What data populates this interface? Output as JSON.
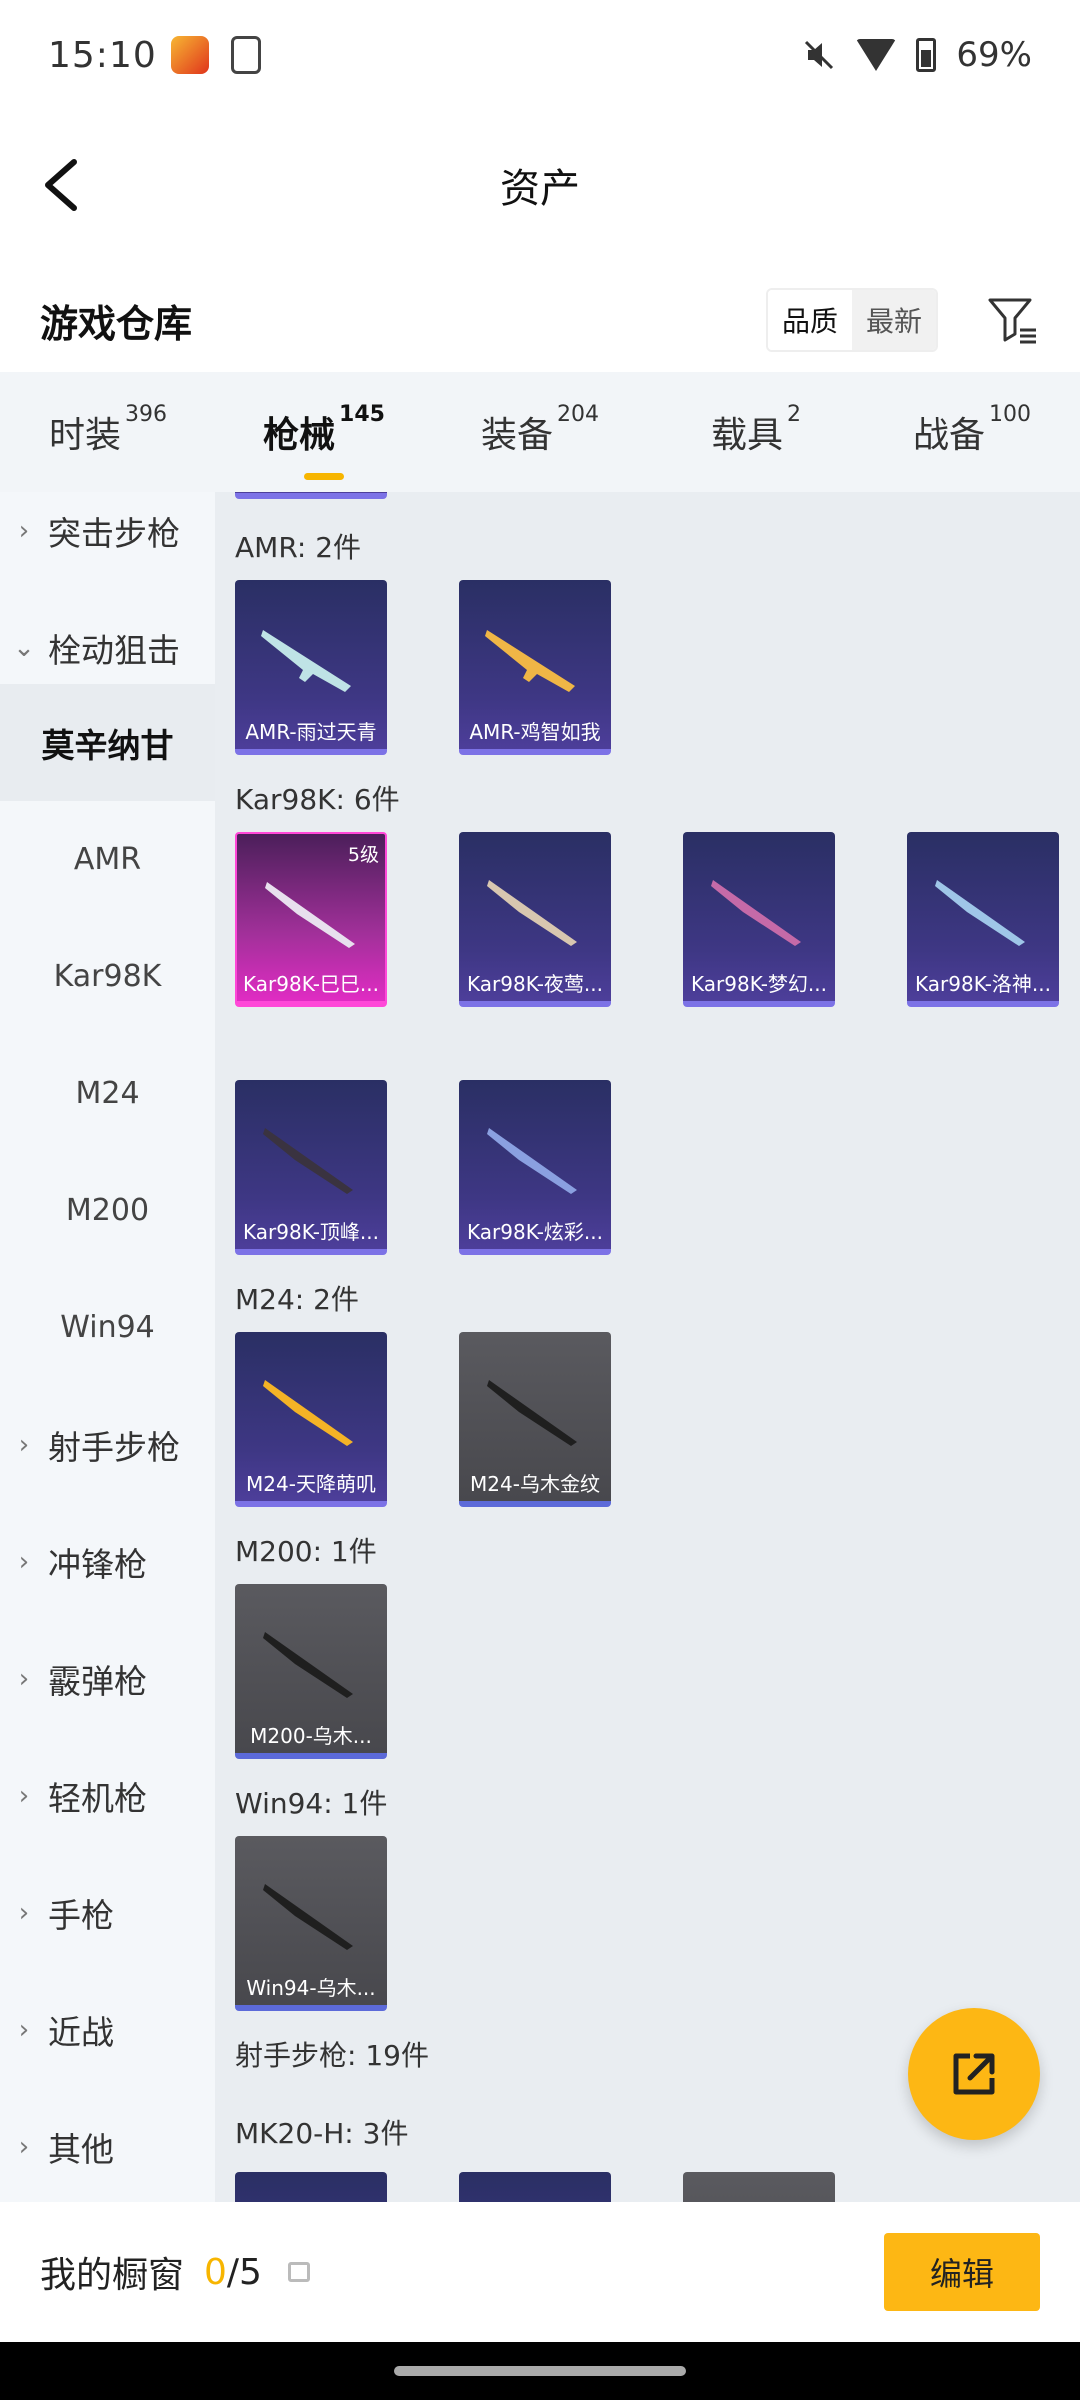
{
  "status_bar": {
    "time": "15:10",
    "battery": "69%"
  },
  "header": {
    "title": "资产"
  },
  "warehouse": {
    "title": "游戏仓库",
    "sort_options": [
      "品质",
      "最新"
    ]
  },
  "category_tabs": [
    {
      "label": "时装",
      "count": "396"
    },
    {
      "label": "枪械",
      "count": "145"
    },
    {
      "label": "装备",
      "count": "204"
    },
    {
      "label": "载具",
      "count": "2"
    },
    {
      "label": "战备",
      "count": "100"
    }
  ],
  "sidebar": {
    "items": [
      "突击步枪",
      "栓动狙击",
      "莫辛纳甘",
      "AMR",
      "Kar98K",
      "M24",
      "M200",
      "Win94",
      "射手步枪",
      "冲锋枪",
      "霰弹枪",
      "轻机枪",
      "手枪",
      "近战",
      "其他"
    ]
  },
  "groups": [
    {
      "label": "AMR: 2件",
      "items": [
        "AMR-雨过天青",
        "AMR-鸡智如我"
      ]
    },
    {
      "label": "Kar98K: 6件",
      "items": [
        "Kar98K-巳巳...",
        "Kar98K-夜莺...",
        "Kar98K-梦幻...",
        "Kar98K-洛神...",
        "Kar98K-顶峰...",
        "Kar98K-炫彩..."
      ]
    },
    {
      "label": "M24: 2件",
      "items": [
        "M24-天降萌叽",
        "M24-乌木金纹"
      ]
    },
    {
      "label": "M200: 1件",
      "items": [
        "M200-乌木..."
      ]
    },
    {
      "label": "Win94: 1件",
      "items": [
        "Win94-乌木..."
      ]
    },
    {
      "label": "射手步枪: 19件",
      "items": []
    },
    {
      "label": "MK20-H: 3件",
      "items": []
    }
  ],
  "level_badge": "5级",
  "bottom_bar": {
    "label": "我的橱窗",
    "count_current": "0",
    "count_total": "/5",
    "edit_label": "编辑"
  },
  "colors": {
    "accent": "#fdb714",
    "card_blue": "#3e3784",
    "card_pink": "#e02cc3",
    "card_gray": "#48484d"
  }
}
